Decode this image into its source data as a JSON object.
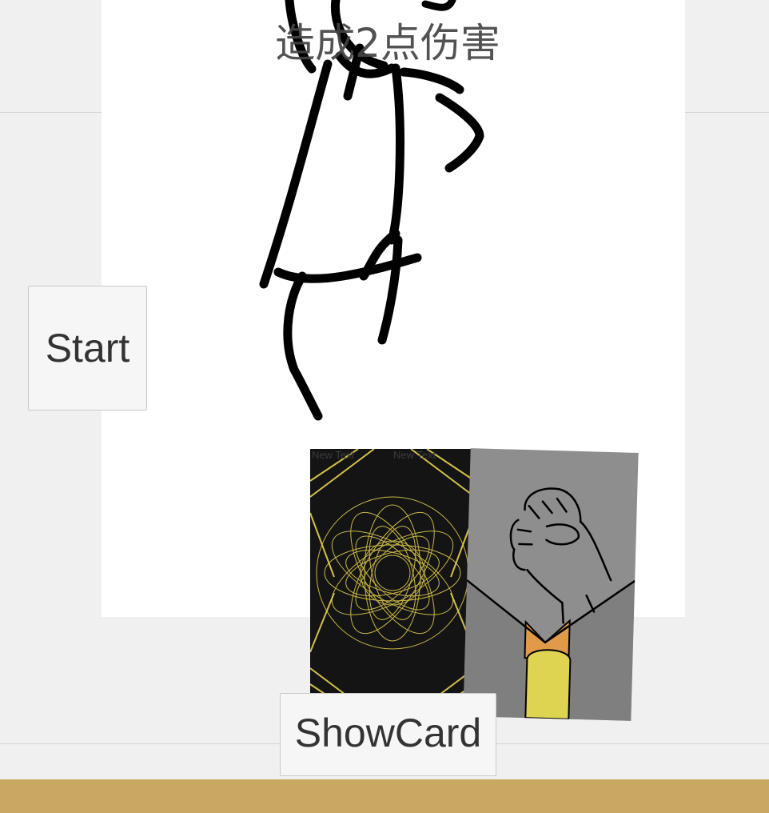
{
  "game": {
    "effect_text": "造成2点伤害",
    "start_button": "Start",
    "showcard_button": "ShowCard"
  },
  "cards": [
    {
      "type": "card-back",
      "labels": [
        "New Text",
        "New Text"
      ]
    },
    {
      "type": "fist-card"
    }
  ],
  "colors": {
    "background": "#f0f0f0",
    "panel": "#ffffff",
    "bottom_bar": "#c9a961",
    "card_back": "#141414",
    "card_gold": "#e8d44f",
    "fist_card_bg": "#8e8e8e",
    "collar_orange": "#e09a4a",
    "tie_yellow": "#dfd451"
  }
}
